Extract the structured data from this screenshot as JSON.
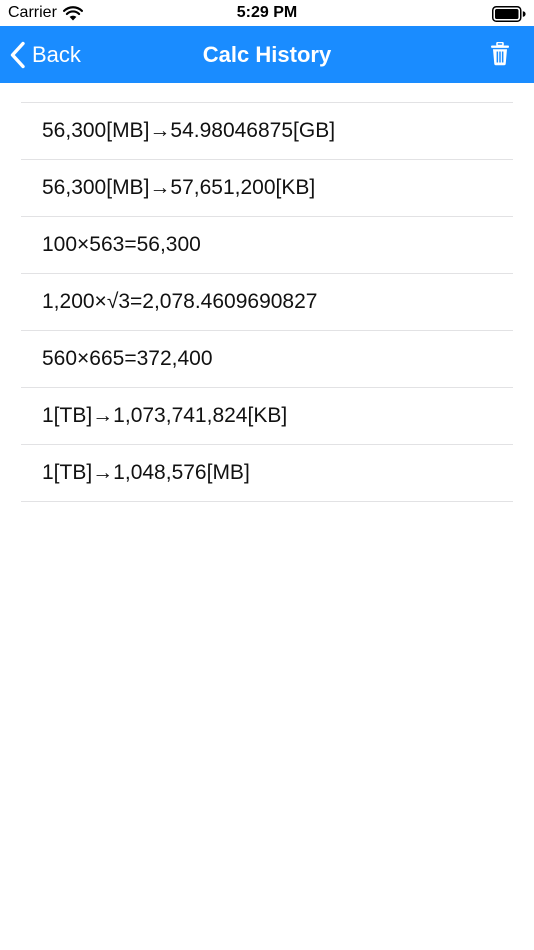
{
  "status_bar": {
    "carrier": "Carrier",
    "time": "5:29 PM"
  },
  "nav": {
    "back_label": "Back",
    "title": "Calc History",
    "accent_color": "#1a8cff"
  },
  "icons": {
    "back": "chevron-left-icon",
    "delete": "trash-icon",
    "wifi": "wifi-icon",
    "battery": "battery-icon"
  },
  "history": {
    "items": [
      "56,300[MB]→54.98046875[GB]",
      "56,300[MB]→57,651,200[KB]",
      "100×563=56,300",
      "1,200×√3=2,078.4609690827",
      "560×665=372,400",
      "1[TB]→1,073,741,824[KB]",
      "1[TB]→1,048,576[MB]"
    ]
  }
}
